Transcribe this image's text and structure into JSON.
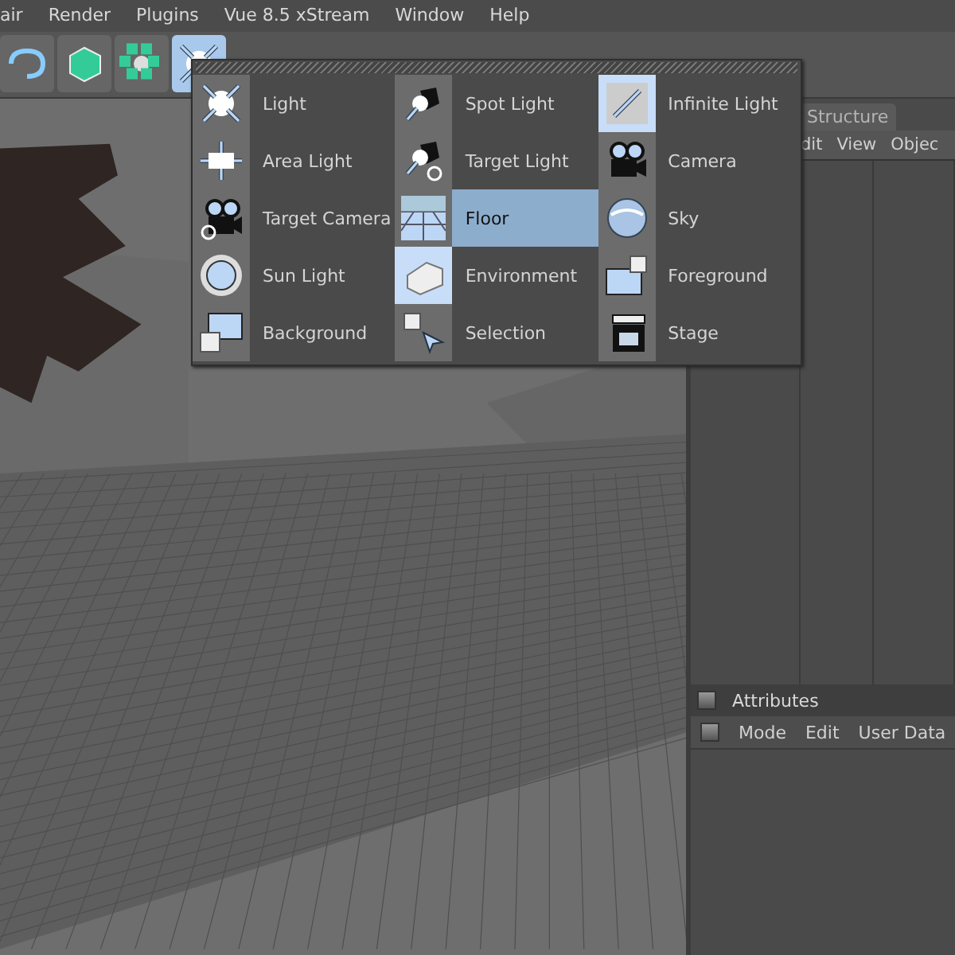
{
  "menu_bar": [
    "air",
    "Render",
    "Plugins",
    "Vue 8.5 xStream",
    "Window",
    "Help"
  ],
  "toolbar": [
    {
      "selected": false
    },
    {
      "selected": false
    },
    {
      "selected": false
    },
    {
      "selected": true
    }
  ],
  "object_manager": {
    "tab": "Structure",
    "menu": [
      "dit",
      "View",
      "Objec"
    ]
  },
  "attributes": {
    "title": "Attributes",
    "menu": [
      "Mode",
      "Edit",
      "User Data"
    ]
  },
  "popup_menu": {
    "items": [
      {
        "label": "Light",
        "selected": false
      },
      {
        "label": "Spot Light",
        "selected": false
      },
      {
        "label": "Infinite Light",
        "selected": false
      },
      {
        "label": "Area Light",
        "selected": false
      },
      {
        "label": "Target Light",
        "selected": false
      },
      {
        "label": "Camera",
        "selected": false
      },
      {
        "label": "Target Camera",
        "selected": false
      },
      {
        "label": "Floor",
        "selected": true
      },
      {
        "label": "Sky",
        "selected": false
      },
      {
        "label": "Sun Light",
        "selected": false
      },
      {
        "label": "Environment",
        "selected": false
      },
      {
        "label": "Foreground",
        "selected": false
      },
      {
        "label": "Background",
        "selected": false
      },
      {
        "label": "Selection",
        "selected": false
      },
      {
        "label": "Stage",
        "selected": false
      }
    ]
  }
}
